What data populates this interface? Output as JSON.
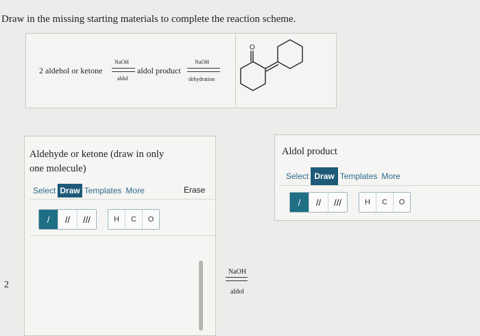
{
  "prompt": "Draw in the missing starting materials to complete the reaction scheme.",
  "scheme": {
    "reactant": "2 aldehol or ketone",
    "arrow1_top": "NaOH",
    "arrow1_bottom": "aldol",
    "intermediate": "aldol product",
    "arrow2_top": "NaOH",
    "arrow2_bottom": "dehydration",
    "product_atom": "O"
  },
  "left_panel": {
    "title_line1": "Aldehyde or ketone (draw in only",
    "title_line2": "one molecule)",
    "tabs": [
      "Select",
      "Draw",
      "Templates",
      "More"
    ],
    "active_tab": "Draw",
    "erase": "Erase",
    "bond_tools": [
      "/",
      "//",
      "///"
    ],
    "atoms": [
      "H",
      "C",
      "O"
    ]
  },
  "right_panel": {
    "title": "Aldol product",
    "tabs": [
      "Select",
      "Draw",
      "Templates",
      "More"
    ],
    "active_tab": "Draw",
    "bond_tools": [
      "/",
      "//",
      "///"
    ],
    "atoms": [
      "H",
      "C",
      "O"
    ]
  },
  "middle_arrow": {
    "top": "NaOH",
    "bottom": "aldol"
  },
  "coefficient": "2"
}
